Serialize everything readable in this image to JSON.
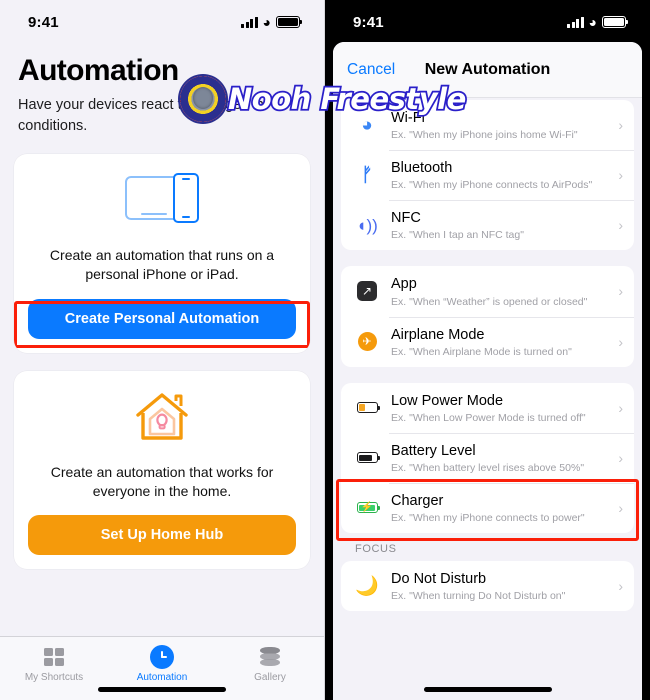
{
  "left": {
    "status": {
      "time": "9:41",
      "signal_icon": "cellular-bars-icon",
      "wifi_icon": "wifi-icon",
      "battery_icon": "battery-icon"
    },
    "title": "Automation",
    "subtitle": "Have your devices react to changes in conditions.",
    "cards": [
      {
        "art_icon": "devices-ipad-iphone-icon",
        "description": "Create an automation that runs on a personal iPhone or iPad.",
        "button_label": "Create Personal Automation",
        "button_color": "#0a7aff",
        "highlighted": true
      },
      {
        "art_icon": "home-house-icon",
        "description": "Create an automation that works for everyone in the home.",
        "button_label": "Set Up Home Hub",
        "button_color": "#f59a0b",
        "highlighted": false
      }
    ],
    "tabs": [
      {
        "label": "My Shortcuts",
        "icon": "grid-icon",
        "active": false
      },
      {
        "label": "Automation",
        "icon": "clock-icon",
        "active": true
      },
      {
        "label": "Gallery",
        "icon": "layers-icon",
        "active": false
      }
    ]
  },
  "right": {
    "status": {
      "time": "9:41",
      "signal_icon": "cellular-bars-icon",
      "wifi_icon": "wifi-icon",
      "battery_icon": "battery-icon"
    },
    "nav": {
      "cancel_label": "Cancel",
      "title": "New Automation"
    },
    "groups": [
      {
        "rows": [
          {
            "title": "Wi-Fi",
            "subtitle": "Ex. \"When my iPhone joins home Wi-Fi\"",
            "icon": "wifi-icon"
          },
          {
            "title": "Bluetooth",
            "subtitle": "Ex. \"When my iPhone connects to AirPods\"",
            "icon": "bluetooth-icon"
          },
          {
            "title": "NFC",
            "subtitle": "Ex. \"When I tap an NFC tag\"",
            "icon": "nfc-icon"
          }
        ]
      },
      {
        "rows": [
          {
            "title": "App",
            "subtitle": "Ex. \"When “Weather” is opened or closed\"",
            "icon": "app-icon"
          },
          {
            "title": "Airplane Mode",
            "subtitle": "Ex. \"When Airplane Mode is turned on\"",
            "icon": "airplane-mode-icon"
          }
        ]
      },
      {
        "rows": [
          {
            "title": "Low Power Mode",
            "subtitle": "Ex. \"When Low Power Mode is turned off\"",
            "icon": "battery-low-power-icon"
          },
          {
            "title": "Battery Level",
            "subtitle": "Ex. \"When battery level rises above 50%\"",
            "icon": "battery-level-icon"
          },
          {
            "title": "Charger",
            "subtitle": "Ex. \"When my iPhone connects to power\"",
            "icon": "charger-icon"
          }
        ]
      }
    ],
    "focus_section": {
      "header": "FOCUS",
      "rows": [
        {
          "title": "Do Not Disturb",
          "subtitle": "Ex. \"When turning Do Not Disturb on\"",
          "icon": "moon-icon"
        }
      ]
    },
    "highlight_target": "Low Power Mode"
  },
  "watermark": {
    "text": "Nooh Freestyle",
    "logo_icon": "circular-badge-logo-icon"
  },
  "colors": {
    "accent_blue": "#0a7aff",
    "accent_orange": "#f59a0b",
    "highlight_red": "#fb1f09"
  }
}
